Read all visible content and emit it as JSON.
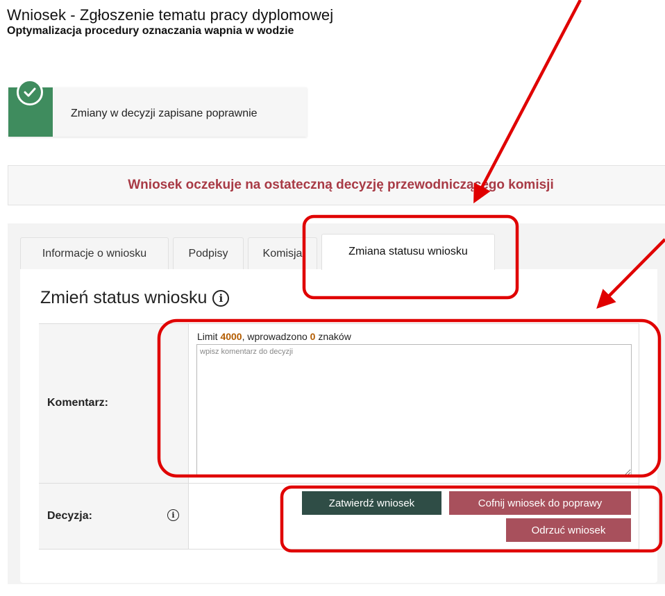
{
  "header": {
    "title": "Wniosek - Zgłoszenie tematu pracy dyplomowej",
    "subtitle": "Optymalizacja procedury oznaczania wapnia w wodzie"
  },
  "toast": {
    "message": "Zmiany w decyzji zapisane poprawnie",
    "icon": "check-icon",
    "color": "#3f8c5e"
  },
  "status_banner": {
    "text": "Wniosek oczekuje na ostateczną decyzję przewodniczącego komisji",
    "color": "#a83a45"
  },
  "tabs": [
    {
      "label": "Informacje o wniosku",
      "active": false
    },
    {
      "label": "Podpisy",
      "active": false
    },
    {
      "label": "Komisja",
      "active": false
    },
    {
      "label": "Zmiana statusu wniosku",
      "active": true
    }
  ],
  "form": {
    "section_title": "Zmień status wniosku",
    "section_info_icon": "info-icon",
    "comment": {
      "label": "Komentarz:",
      "limit_prefix": "Limit",
      "limit_value": "4000",
      "entered_prefix": ", wprowadzono",
      "entered_value": "0",
      "entered_suffix": "znaków",
      "placeholder": "wpisz komentarz do decyzji",
      "value": ""
    },
    "decision": {
      "label": "Decyzja:",
      "info_icon": "info-icon",
      "buttons": {
        "approve": "Zatwierdź wniosek",
        "return": "Cofnij wniosek do poprawy",
        "reject": "Odrzuć wniosek"
      }
    }
  },
  "colors": {
    "approve_button": "#2f4d46",
    "return_button": "#a8505c",
    "reject_button": "#a8505c",
    "annotation": "#e00000"
  }
}
